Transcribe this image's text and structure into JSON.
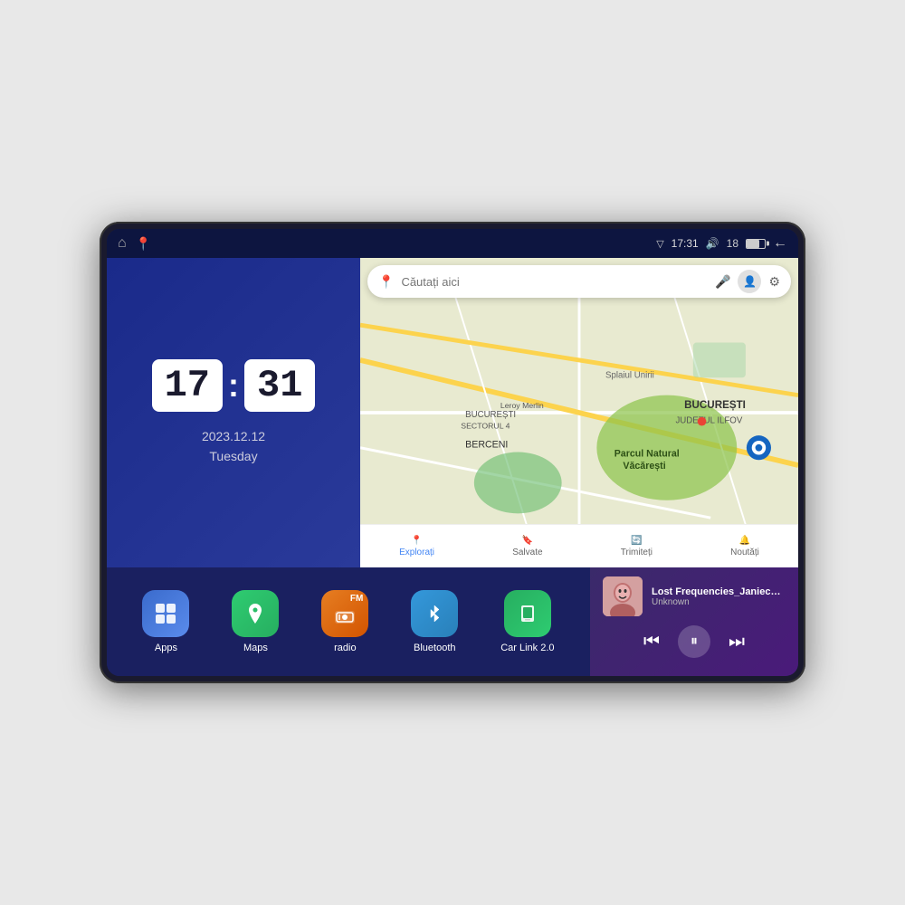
{
  "device": {
    "status_bar": {
      "time": "17:31",
      "signal_strength": "18",
      "back_label": "←"
    },
    "clock_widget": {
      "hours": "17",
      "minutes": "31",
      "date": "2023.12.12",
      "day": "Tuesday"
    },
    "map_widget": {
      "search_placeholder": "Căutați aici",
      "bottom_items": [
        {
          "label": "Explorați",
          "icon": "📍"
        },
        {
          "label": "Salvate",
          "icon": "🔖"
        },
        {
          "label": "Trimiteți",
          "icon": "🔄"
        },
        {
          "label": "Noutăți",
          "icon": "🔔"
        }
      ]
    },
    "apps": [
      {
        "label": "Apps",
        "icon": "⊞",
        "color_class": "app-apps"
      },
      {
        "label": "Maps",
        "icon": "🗺",
        "color_class": "app-maps"
      },
      {
        "label": "radio",
        "icon": "📻",
        "color_class": "app-radio"
      },
      {
        "label": "Bluetooth",
        "icon": "🔷",
        "color_class": "app-bluetooth"
      },
      {
        "label": "Car Link 2.0",
        "icon": "📱",
        "color_class": "app-carlink"
      }
    ],
    "music": {
      "title": "Lost Frequencies_Janieck Devy-...",
      "artist": "Unknown",
      "controls": {
        "prev": "⏮",
        "play": "⏸",
        "next": "⏭"
      }
    }
  }
}
